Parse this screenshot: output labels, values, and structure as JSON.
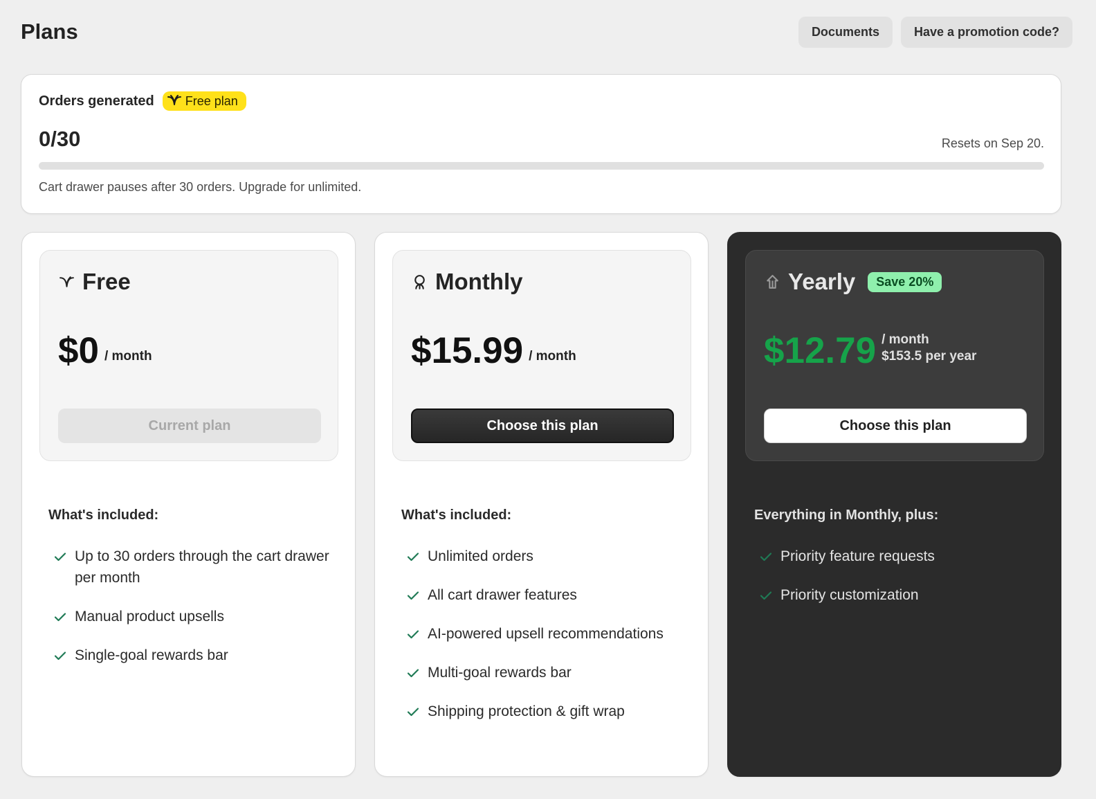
{
  "header": {
    "title": "Plans",
    "documents_label": "Documents",
    "promo_label": "Have a promotion code?"
  },
  "usage": {
    "label": "Orders generated",
    "badge": "Free plan",
    "count": "0/30",
    "progress_fraction": 0,
    "reset": "Resets on Sep 20.",
    "note": "Cart drawer pauses after 30 orders. Upgrade for unlimited."
  },
  "plans": [
    {
      "name": "Free",
      "icon": "leaf-icon",
      "price": "$0",
      "per": "/ month",
      "button": "Current plan",
      "included_title": "What's included:",
      "features": [
        "Up to 30 orders through the cart drawer per month",
        "Manual product upsells",
        "Single-goal rewards bar"
      ]
    },
    {
      "name": "Monthly",
      "icon": "sprout-icon",
      "price": "$15.99",
      "per": "/ month",
      "button": "Choose this plan",
      "included_title": "What's included:",
      "features": [
        "Unlimited orders",
        "All cart drawer features",
        "AI-powered upsell recommendations",
        "Multi-goal rewards bar",
        "Shipping protection & gift wrap"
      ]
    },
    {
      "name": "Yearly",
      "icon": "tree-icon",
      "badge": "Save 20%",
      "price": "$12.79",
      "per": "/ month",
      "per_year": "$153.5 per year",
      "button": "Choose this plan",
      "included_title": "Everything in Monthly, plus:",
      "features": [
        "Priority feature requests",
        "Priority customization"
      ]
    }
  ],
  "colors": {
    "accent_green": "#16a34a",
    "badge_yellow": "#ffe11a",
    "save_badge": "#8ff0ad",
    "dark_card": "#2b2b2b",
    "check_green": "#1f7a55"
  }
}
